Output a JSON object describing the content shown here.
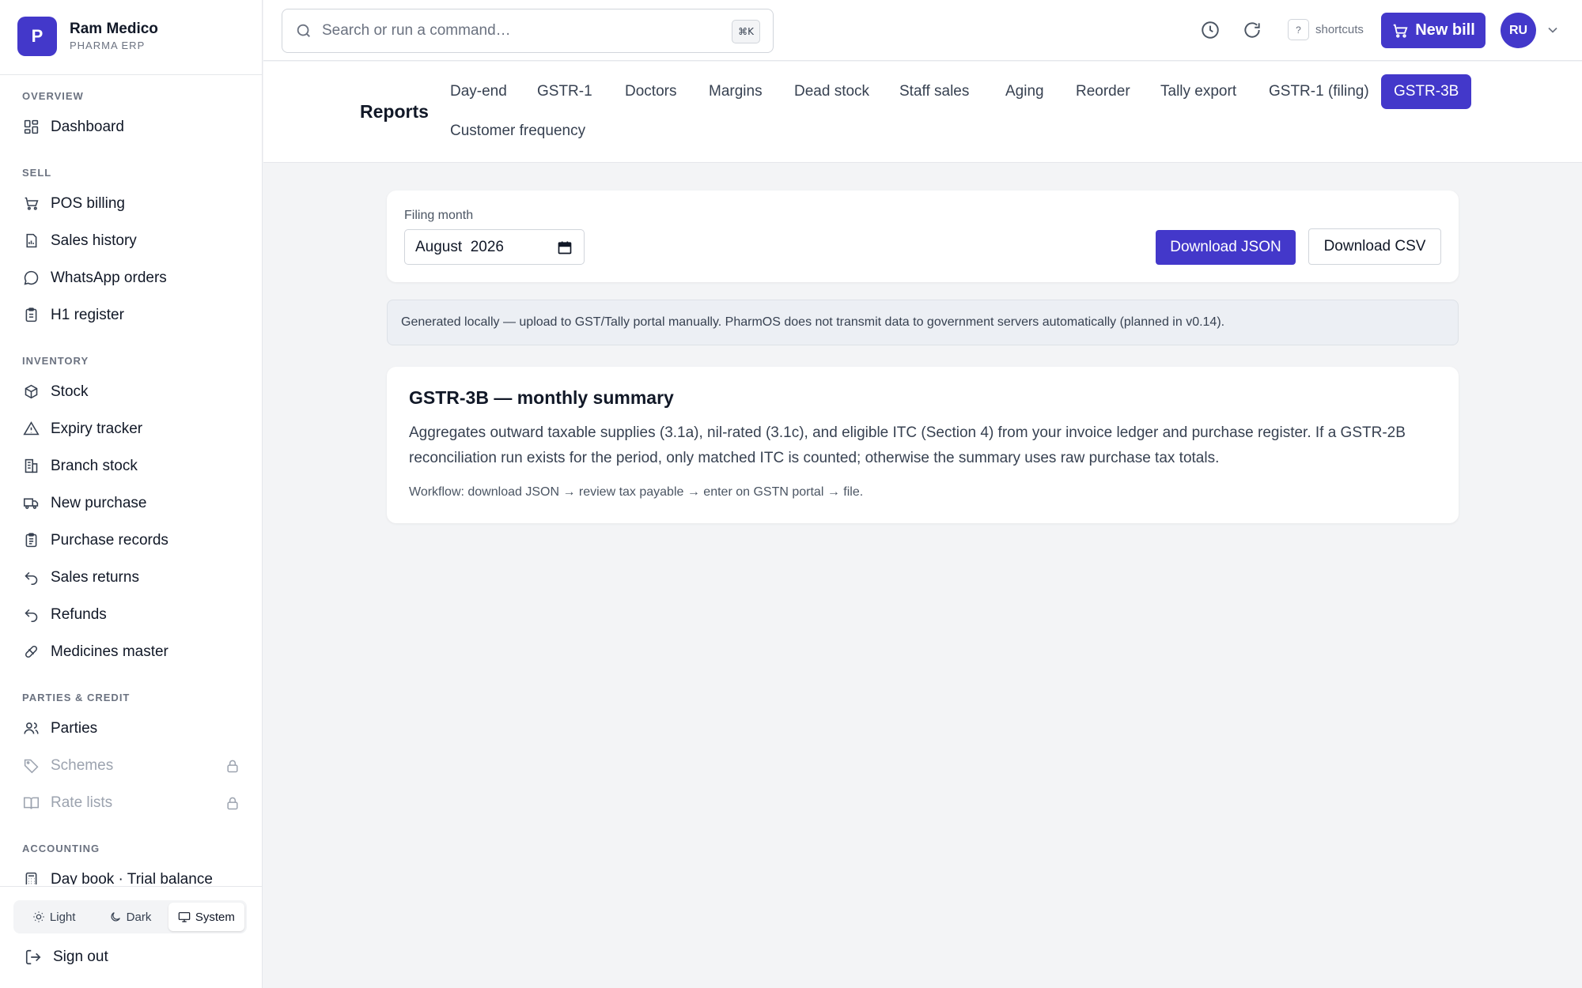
{
  "brand": {
    "logo_letter": "P",
    "name": "Ram Medico",
    "subtitle": "PHARMA ERP"
  },
  "sidebar": {
    "sections": [
      {
        "title": "OVERVIEW",
        "items": [
          {
            "label": "Dashboard",
            "icon": "dashboard-icon"
          }
        ]
      },
      {
        "title": "SELL",
        "items": [
          {
            "label": "POS billing",
            "icon": "cart-icon"
          },
          {
            "label": "Sales history",
            "icon": "receipt-icon"
          },
          {
            "label": "WhatsApp orders",
            "icon": "chat-bubble-icon"
          },
          {
            "label": "H1 register",
            "icon": "clipboard-icon"
          }
        ]
      },
      {
        "title": "INVENTORY",
        "items": [
          {
            "label": "Stock",
            "icon": "package-icon"
          },
          {
            "label": "Expiry tracker",
            "icon": "warning-icon"
          },
          {
            "label": "Branch stock",
            "icon": "building-icon"
          },
          {
            "label": "New purchase",
            "icon": "truck-icon"
          },
          {
            "label": "Purchase records",
            "icon": "clipboard-list-icon"
          },
          {
            "label": "Sales returns",
            "icon": "undo-icon"
          },
          {
            "label": "Refunds",
            "icon": "undo-icon"
          },
          {
            "label": "Medicines master",
            "icon": "pill-icon"
          }
        ]
      },
      {
        "title": "PARTIES & CREDIT",
        "items": [
          {
            "label": "Parties",
            "icon": "users-icon"
          },
          {
            "label": "Schemes",
            "icon": "tag-icon",
            "locked": true
          },
          {
            "label": "Rate lists",
            "icon": "book-icon",
            "locked": true
          }
        ]
      },
      {
        "title": "ACCOUNTING",
        "items": [
          {
            "label": "Day book · Trial balance",
            "icon": "calculator-icon"
          }
        ]
      }
    ]
  },
  "theme": {
    "light": "Light",
    "dark": "Dark",
    "system": "System",
    "selected": "System"
  },
  "signout": "Sign out",
  "topbar": {
    "search_placeholder": "Search or run a command…",
    "search_kbd": "⌘K",
    "shortcuts_key": "?",
    "shortcuts_label": "shortcuts",
    "new_bill": "New bill",
    "avatar_initials": "RU"
  },
  "reports": {
    "title": "Reports",
    "tabs": [
      "Day-end",
      "GSTR-1",
      "Doctors",
      "Margins",
      "Dead stock",
      "Staff sales",
      "Aging",
      "Reorder",
      "Tally export",
      "GSTR-1 (filing)",
      "GSTR-3B",
      "Customer frequency"
    ],
    "active_tab": "GSTR-3B"
  },
  "filing": {
    "label": "Filing month",
    "value": "August  2026",
    "download_json": "Download JSON",
    "download_csv": "Download CSV"
  },
  "notice": "Generated locally — upload to GST/Tally portal manually. PharmOS does not transmit data to government servers automatically (planned in v0.14).",
  "summary": {
    "title": "GSTR-3B — monthly summary",
    "description": "Aggregates outward taxable supplies (3.1a), nil-rated (3.1c), and eligible ITC (Section 4) from your invoice ledger and purchase register. If a GSTR-2B reconciliation run exists for the period, only matched ITC is counted; otherwise the summary uses raw purchase tax totals.",
    "workflow": "Workflow: download JSON → review tax payable → enter on GSTN portal → file."
  },
  "colors": {
    "accent": "#4338ca",
    "background": "#f3f4f6"
  }
}
